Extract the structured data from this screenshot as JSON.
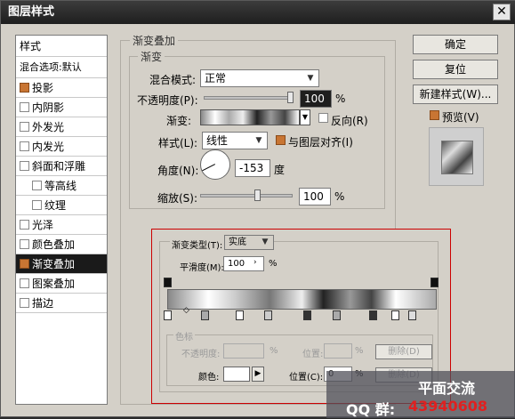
{
  "window": {
    "title": "图层样式",
    "close_icon": "close-icon"
  },
  "left_panel": {
    "header": "样式",
    "blend": "混合选项:默认",
    "items": [
      {
        "label": "投影",
        "checked": true
      },
      {
        "label": "内阴影",
        "checked": false
      },
      {
        "label": "外发光",
        "checked": false
      },
      {
        "label": "内发光",
        "checked": false
      },
      {
        "label": "斜面和浮雕",
        "checked": false
      },
      {
        "label": "等高线",
        "checked": false
      },
      {
        "label": "纹理",
        "checked": false
      },
      {
        "label": "光泽",
        "checked": false
      },
      {
        "label": "颜色叠加",
        "checked": false
      },
      {
        "label": "渐变叠加",
        "checked": true,
        "selected": true
      },
      {
        "label": "图案叠加",
        "checked": false
      },
      {
        "label": "描边",
        "checked": false
      }
    ]
  },
  "overlay": {
    "group_title": "渐变叠加",
    "sub_title": "渐变",
    "blend_mode_label": "混合模式:",
    "blend_mode_value": "正常",
    "opacity_label": "不透明度(P):",
    "opacity_value": "100",
    "percent": "%",
    "gradient_label": "渐变:",
    "reverse_label": "反向(R)",
    "style_label": "样式(L):",
    "style_value": "线性",
    "align_label": "与图层对齐(I)",
    "angle_label": "角度(N):",
    "angle_value": "-153",
    "degree": "度",
    "scale_label": "缩放(S):",
    "scale_value": "100"
  },
  "buttons": {
    "ok": "确定",
    "reset": "复位",
    "new_style": "新建样式(W)...",
    "preview": "预览(V)"
  },
  "editor": {
    "type_label": "渐变类型(T):",
    "type_value": "实底",
    "smooth_label": "平滑度(M):",
    "smooth_value": "100",
    "smooth_unit": "%",
    "stops_title": "色标",
    "opacity_label": "不透明度:",
    "opacity_unit": "%",
    "location_label": "位置:",
    "location_unit": "%",
    "delete_label": "删除(D)",
    "color_label": "颜色:",
    "location2_label": "位置(C):",
    "location2_value": "0",
    "location2_unit": "%",
    "delete2_label": "删除(D)"
  },
  "watermark": {
    "line1": "平面交流",
    "qq_label": "QQ 群:",
    "qq_number": "43940608"
  }
}
